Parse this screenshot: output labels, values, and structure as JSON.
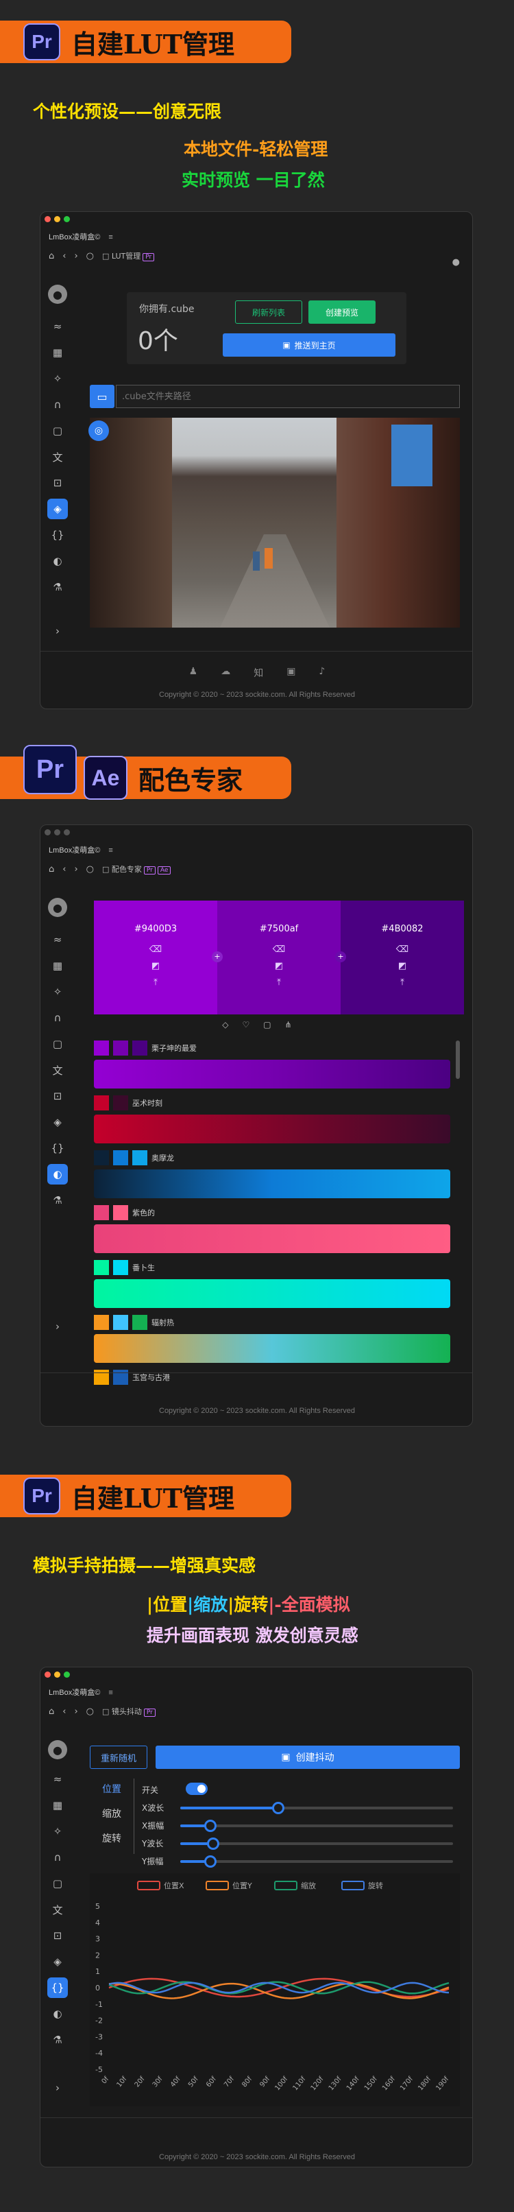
{
  "sections": [
    {
      "title": "自建LUT管理"
    },
    {
      "title": "配色专家"
    },
    {
      "title": "自建LUT管理"
    }
  ],
  "badges": {
    "pr": "Pr",
    "ae": "Ae"
  },
  "s1": {
    "line1": "个性化预设——创意无限",
    "line2": "本地文件-轻松管理",
    "line3": "实时预览 一目了然",
    "app_title": "LmBox凌萌盒©",
    "menu": "≡",
    "crumb": "LUT管理",
    "crumb_badge": "Pr",
    "you_have": "你拥有.cube",
    "count": "0个",
    "refresh": "刷新列表",
    "create_preview": "创建预览",
    "push_home": "推送到主页",
    "path_placeholder": ".cube文件夹路径",
    "footer": "Copyright © 2020 ~ 2023 sockite.com. All Rights Reserved"
  },
  "s2": {
    "app_title": "LmBox凌萌盒©",
    "crumb": "配色专家",
    "crumb_badges": [
      "Pr",
      "Ae"
    ],
    "colors": [
      {
        "hex": "#9400D3",
        "value": "#9400D3"
      },
      {
        "hex": "#7500af",
        "value": "#7500af"
      },
      {
        "hex": "#4B0082",
        "value": "#4B0082"
      }
    ],
    "palettes": [
      {
        "name": "栗子坤的最爱",
        "swatches": [
          "#9400d3",
          "#7500af",
          "#4b0082"
        ],
        "gradient": "linear-gradient(90deg,#9400d3,#7500af,#4b0082)"
      },
      {
        "name": "巫术时刻",
        "swatches": [
          "#c4002b",
          "#3a0a2a"
        ],
        "gradient": "linear-gradient(90deg,#c4002b,#3a0a2a)"
      },
      {
        "name": "奥摩龙",
        "swatches": [
          "#0c2238",
          "#0d7bd6",
          "#0ea5e9"
        ],
        "gradient": "linear-gradient(90deg,#0c2238,#0d7bd6,#0ea5e9)"
      },
      {
        "name": "紫色的",
        "swatches": [
          "#e9427a",
          "#ff5d84"
        ],
        "gradient": "linear-gradient(90deg,#e9427a,#ff5d84)"
      },
      {
        "name": "番卜生",
        "swatches": [
          "#00f5a0",
          "#00d9f5"
        ],
        "gradient": "linear-gradient(90deg,#00f5a0,#00d9f5)"
      },
      {
        "name": "辐射热",
        "swatches": [
          "#f7971e",
          "#40c4ff",
          "#14b152"
        ],
        "gradient": "linear-gradient(90deg,#f7971e,#57c7d9,#14b152)"
      },
      {
        "name": "玉宫与古港",
        "swatches": [
          "#f6a400",
          "#1a5eb5"
        ],
        "gradient": ""
      }
    ],
    "footer": "Copyright © 2020 ~ 2023 sockite.com. All Rights Reserved"
  },
  "s3": {
    "line1": "模拟手持拍摄——增强真实感",
    "line2_parts": [
      "|位置",
      "|缩放",
      "|旋转",
      "|-全面模拟"
    ],
    "line3": "提升画面表现 激发创意灵感",
    "app_title": "LmBox凌萌盒©",
    "crumb": "镜头抖动",
    "crumb_badge": "Pr",
    "refresh_btn": "重新随机",
    "create_btn": "创建抖动",
    "tabs": [
      "位置",
      "缩放",
      "旋转"
    ],
    "toggle_label": "开关",
    "sliders": [
      {
        "label": "X波长",
        "value": 0.36
      },
      {
        "label": "X振幅",
        "value": 0.11
      },
      {
        "label": "Y波长",
        "value": 0.12
      },
      {
        "label": "Y振幅",
        "value": 0.11
      }
    ],
    "footer": "Copyright © 2020 ~ 2023 sockite.com. All Rights Reserved"
  },
  "chart_data": {
    "type": "line",
    "series": [
      {
        "name": "位置X",
        "color": "#e0483e"
      },
      {
        "name": "位置Y",
        "color": "#f0832a"
      },
      {
        "name": "缩放",
        "color": "#1d9a6c"
      },
      {
        "name": "旋转",
        "color": "#3f7be0"
      }
    ],
    "x": [
      "0f",
      "10f",
      "20f",
      "30f",
      "40f",
      "50f",
      "60f",
      "70f",
      "80f",
      "90f",
      "100f",
      "110f",
      "120f",
      "130f",
      "140f",
      "150f",
      "160f",
      "170f",
      "180f",
      "190f"
    ],
    "ylim": [
      -5,
      5
    ],
    "yticks": [
      5,
      4,
      3,
      2,
      1,
      0,
      -1,
      -2,
      -3,
      -4,
      -5
    ]
  }
}
